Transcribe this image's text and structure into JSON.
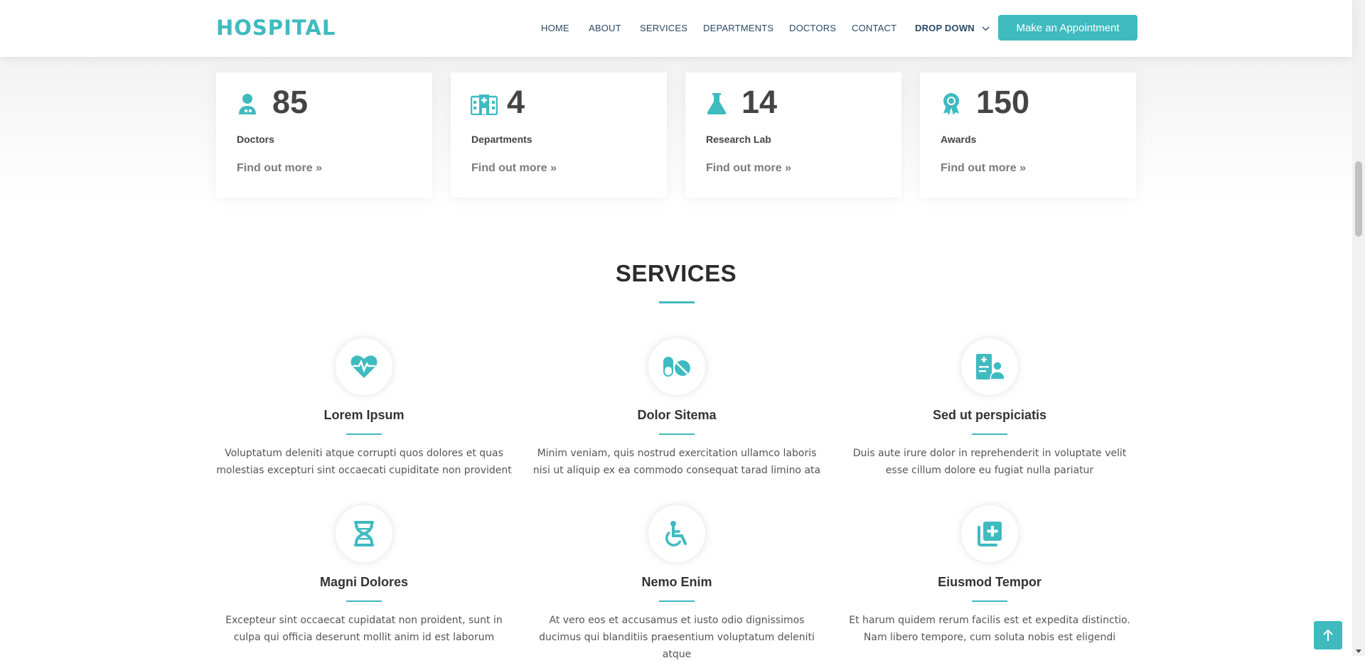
{
  "header": {
    "logo": "HOSPITAL",
    "nav": [
      "HOME",
      "ABOUT",
      "SERVICES",
      "DEPARTMENTS",
      "DOCTORS",
      "CONTACT",
      "DROP DOWN"
    ],
    "cta": "Make an Appointment"
  },
  "stats": [
    {
      "value": "85",
      "label": "Doctors",
      "link": "Find out more »",
      "icon": "doctor-icon"
    },
    {
      "value": "4",
      "label": "Departments",
      "link": "Find out more »",
      "icon": "hospital-icon"
    },
    {
      "value": "14",
      "label": "Research Lab",
      "link": "Find out more »",
      "icon": "flask-icon"
    },
    {
      "value": "150",
      "label": "Awards",
      "link": "Find out more »",
      "icon": "award-icon"
    }
  ],
  "services": {
    "title": "SERVICES",
    "items": [
      {
        "title": "Lorem Ipsum",
        "desc": "Voluptatum deleniti atque corrupti quos dolores et quas molestias excepturi sint occaecati cupiditate non provident",
        "icon": "heartbeat-icon"
      },
      {
        "title": "Dolor Sitema",
        "desc": "Minim veniam, quis nostrud exercitation ullamco laboris nisi ut aliquip ex ea commodo consequat tarad limino ata",
        "icon": "pills-icon"
      },
      {
        "title": "Sed ut perspiciatis",
        "desc": "Duis aute irure dolor in reprehenderit in voluptate velit esse cillum dolore eu fugiat nulla pariatur",
        "icon": "medical-staff-icon"
      },
      {
        "title": "Magni Dolores",
        "desc": "Excepteur sint occaecat cupidatat non proident, sunt in culpa qui officia deserunt mollit anim id est laborum",
        "icon": "dna-icon"
      },
      {
        "title": "Nemo Enim",
        "desc": "At vero eos et accusamus et iusto odio dignissimos ducimus qui blanditiis praesentium voluptatum deleniti atque",
        "icon": "wheelchair-icon"
      },
      {
        "title": "Eiusmod Tempor",
        "desc": "Et harum quidem rerum facilis est et expedita distinctio. Nam libero tempore, cum soluta nobis est eligendi",
        "icon": "notes-medical-icon"
      }
    ]
  },
  "colors": {
    "accent": "#3fbbc0",
    "text": "#444444",
    "nav": "#2c4964"
  }
}
